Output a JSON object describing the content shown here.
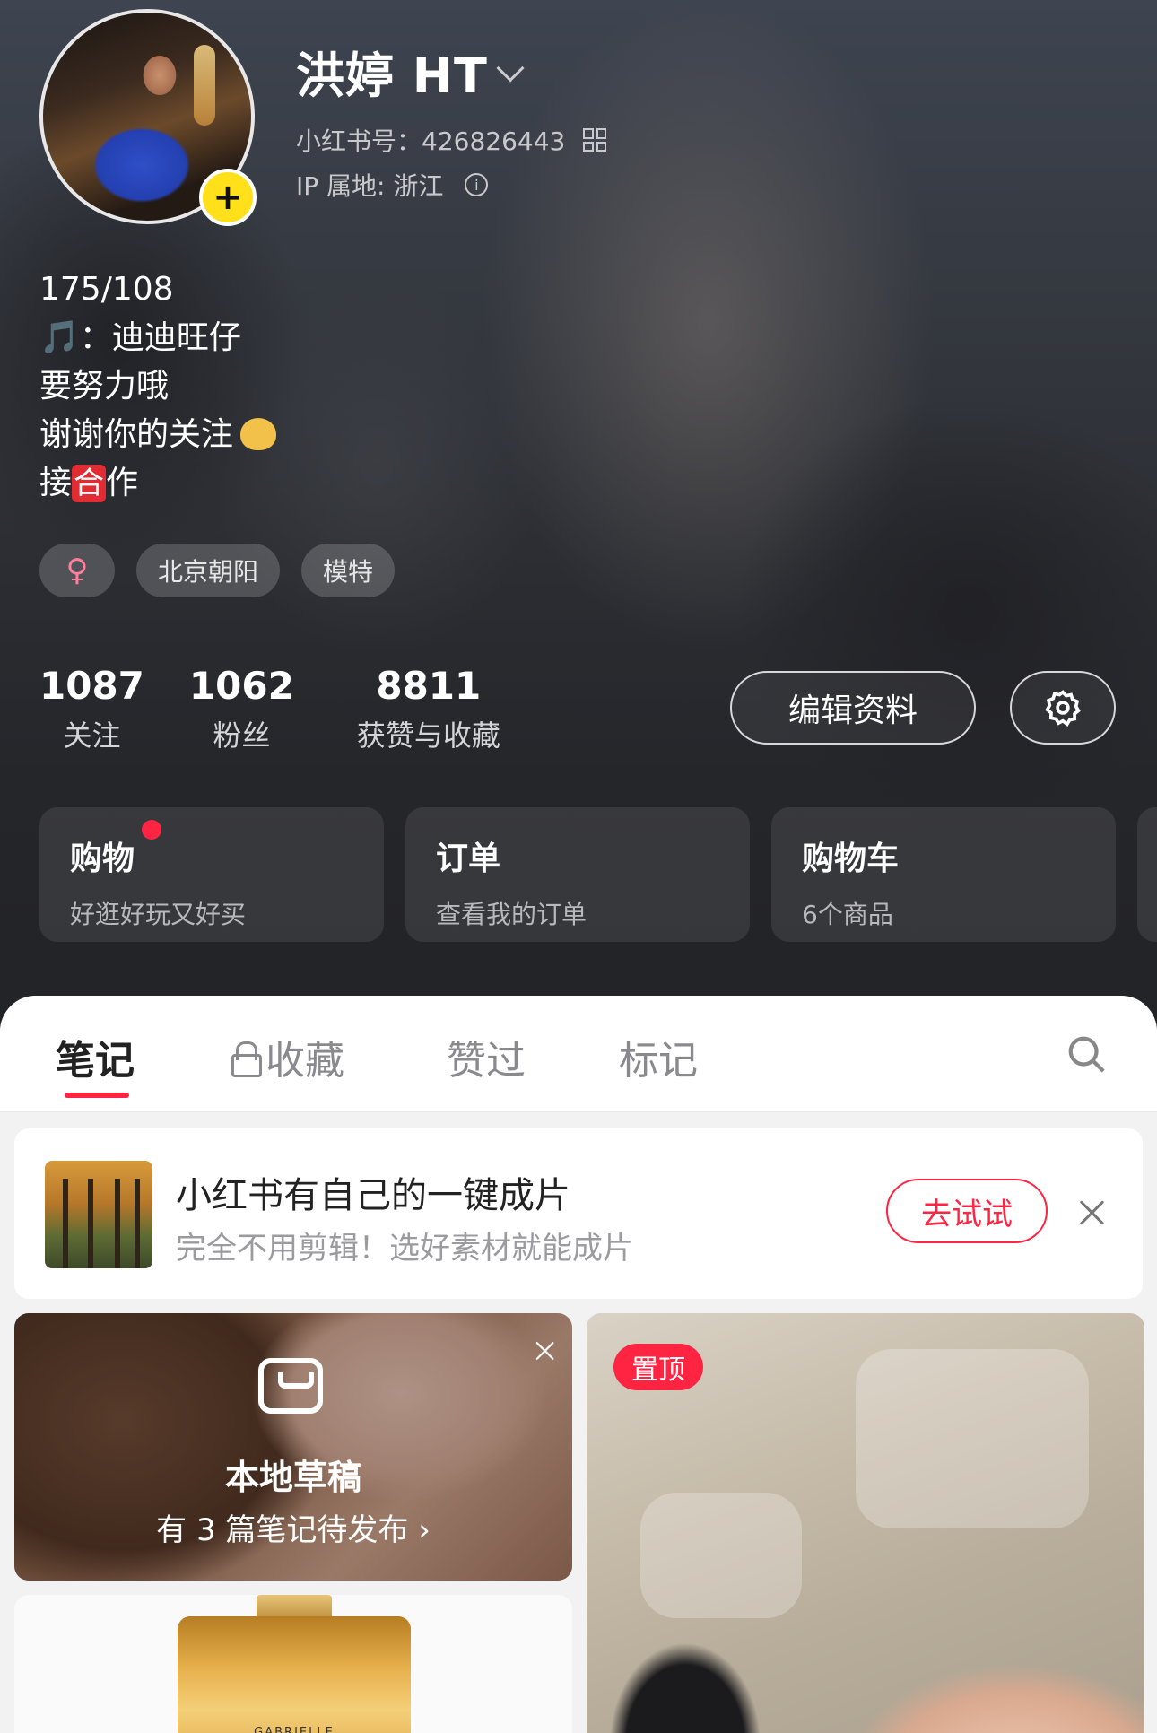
{
  "profile": {
    "name": "洪婷 HT",
    "id_text": "小红书号：426826443",
    "ip_text": "IP 属地: 浙江",
    "bio": {
      "line1": "175/108",
      "line2": "🎵：迪迪旺仔",
      "line3": "要努力哦",
      "line4": "谢谢你的关注",
      "line5_pre": "接",
      "line5_mark": "合",
      "line5_post": "作"
    },
    "tags": [
      "♀",
      "北京朝阳",
      "模特"
    ]
  },
  "stats": [
    {
      "num": "1087",
      "label": "关注"
    },
    {
      "num": "1062",
      "label": "粉丝"
    },
    {
      "num": "8811",
      "label": "获赞与收藏"
    }
  ],
  "actions": {
    "edit_label": "编辑资料",
    "settings_icon": "gear-icon"
  },
  "cards": [
    {
      "title": "购物",
      "sub": "好逛好玩又好买",
      "has_dot": true
    },
    {
      "title": "订单",
      "sub": "查看我的订单"
    },
    {
      "title": "购物车",
      "sub": "6个商品"
    }
  ],
  "tabs": [
    {
      "label": "笔记",
      "active": true
    },
    {
      "label": "收藏",
      "locked": true
    },
    {
      "label": "赞过"
    },
    {
      "label": "标记"
    }
  ],
  "promo": {
    "title": "小红书有自己的一键成片",
    "sub": "完全不用剪辑！选好素材就能成片",
    "button": "去试试"
  },
  "draft": {
    "title": "本地草稿",
    "sub": "有 3 篇笔记待发布 ›"
  },
  "perfume_label": "GABRIELLE",
  "pinned_badge": "置顶",
  "colors": {
    "accent": "#ff2442",
    "badge_yellow": "#ffe01a"
  }
}
